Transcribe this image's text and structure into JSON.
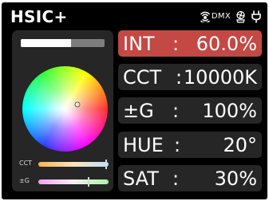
{
  "device": {
    "title": "HSIC+"
  },
  "status": {
    "dmx_label": "DMX",
    "icons": [
      "wireless-dmx-icon",
      "fan-icon",
      "power-plug-icon"
    ]
  },
  "intensity_bar": {
    "fraction": 0.6
  },
  "color_wheel": {
    "hue_deg": 20,
    "saturation_pct": 30
  },
  "sliders": [
    {
      "label": "CCT",
      "fraction": 0.97
    },
    {
      "label": "±G",
      "fraction": 0.72
    }
  ],
  "params": [
    {
      "label": "INT",
      "sep": ":",
      "value": "60.0%",
      "active": true
    },
    {
      "label": "CCT",
      "sep": ":",
      "value": "10000K",
      "active": false
    },
    {
      "label": "±G",
      "sep": ":",
      "value": "100%",
      "active": false
    },
    {
      "label": "HUE",
      "sep": ":",
      "value": "20°",
      "active": false
    },
    {
      "label": "SAT",
      "sep": ":",
      "value": "30%",
      "active": false
    }
  ],
  "colors": {
    "active_row": "#c44844",
    "panel": "#262626",
    "background": "#000000"
  }
}
